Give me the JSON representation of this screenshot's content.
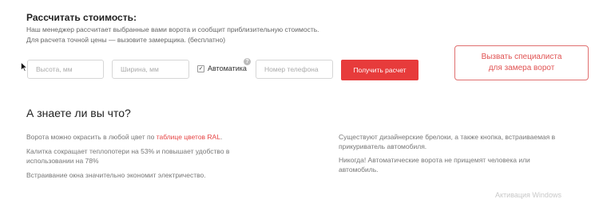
{
  "calculator": {
    "title": "Рассчитать стоимость:",
    "description_line1": "Наш менеджер рассчитает выбранные вами ворота и сообщит приблизительную стоимость.",
    "description_line2": "Для расчета точной цены — вызовите замерщика. (бесплатно)",
    "height_placeholder": "Высота, мм",
    "width_placeholder": "Ширина, мм",
    "automation_label": "Автоматика",
    "automation_checked": true,
    "help_glyph": "?",
    "checkmark_glyph": "✓",
    "phone_placeholder": "Номер телефона",
    "submit_label": "Получить расчет",
    "specialist_line1": "Вызвать специалиста",
    "specialist_line2": "для замера ворот"
  },
  "facts": {
    "title": "А знаете ли вы что?",
    "color_text": "Ворота можно окрасить в любой цвет по",
    "color_link": "таблице цветов RAL",
    "color_end": ".",
    "gate": "Калитка сокращает теплопотери на 53% и повышает удобство в использовании на 78%",
    "window": "Встраивание окна значительно экономит электричество.",
    "fob": "Существуют дизайнерские брелоки, а также кнопка, встраиваемая в прикуриватель автомобиля.",
    "safety": "Никогда! Автоматические ворота не прищемят человека или автомобиль."
  },
  "watermark": "Активация Windows",
  "colors": {
    "accent": "#e73b3b",
    "link": "#e64545",
    "outline_button": "#e07070"
  },
  "icons": [
    "cursor-icon",
    "checkmark-icon",
    "help-icon"
  ]
}
